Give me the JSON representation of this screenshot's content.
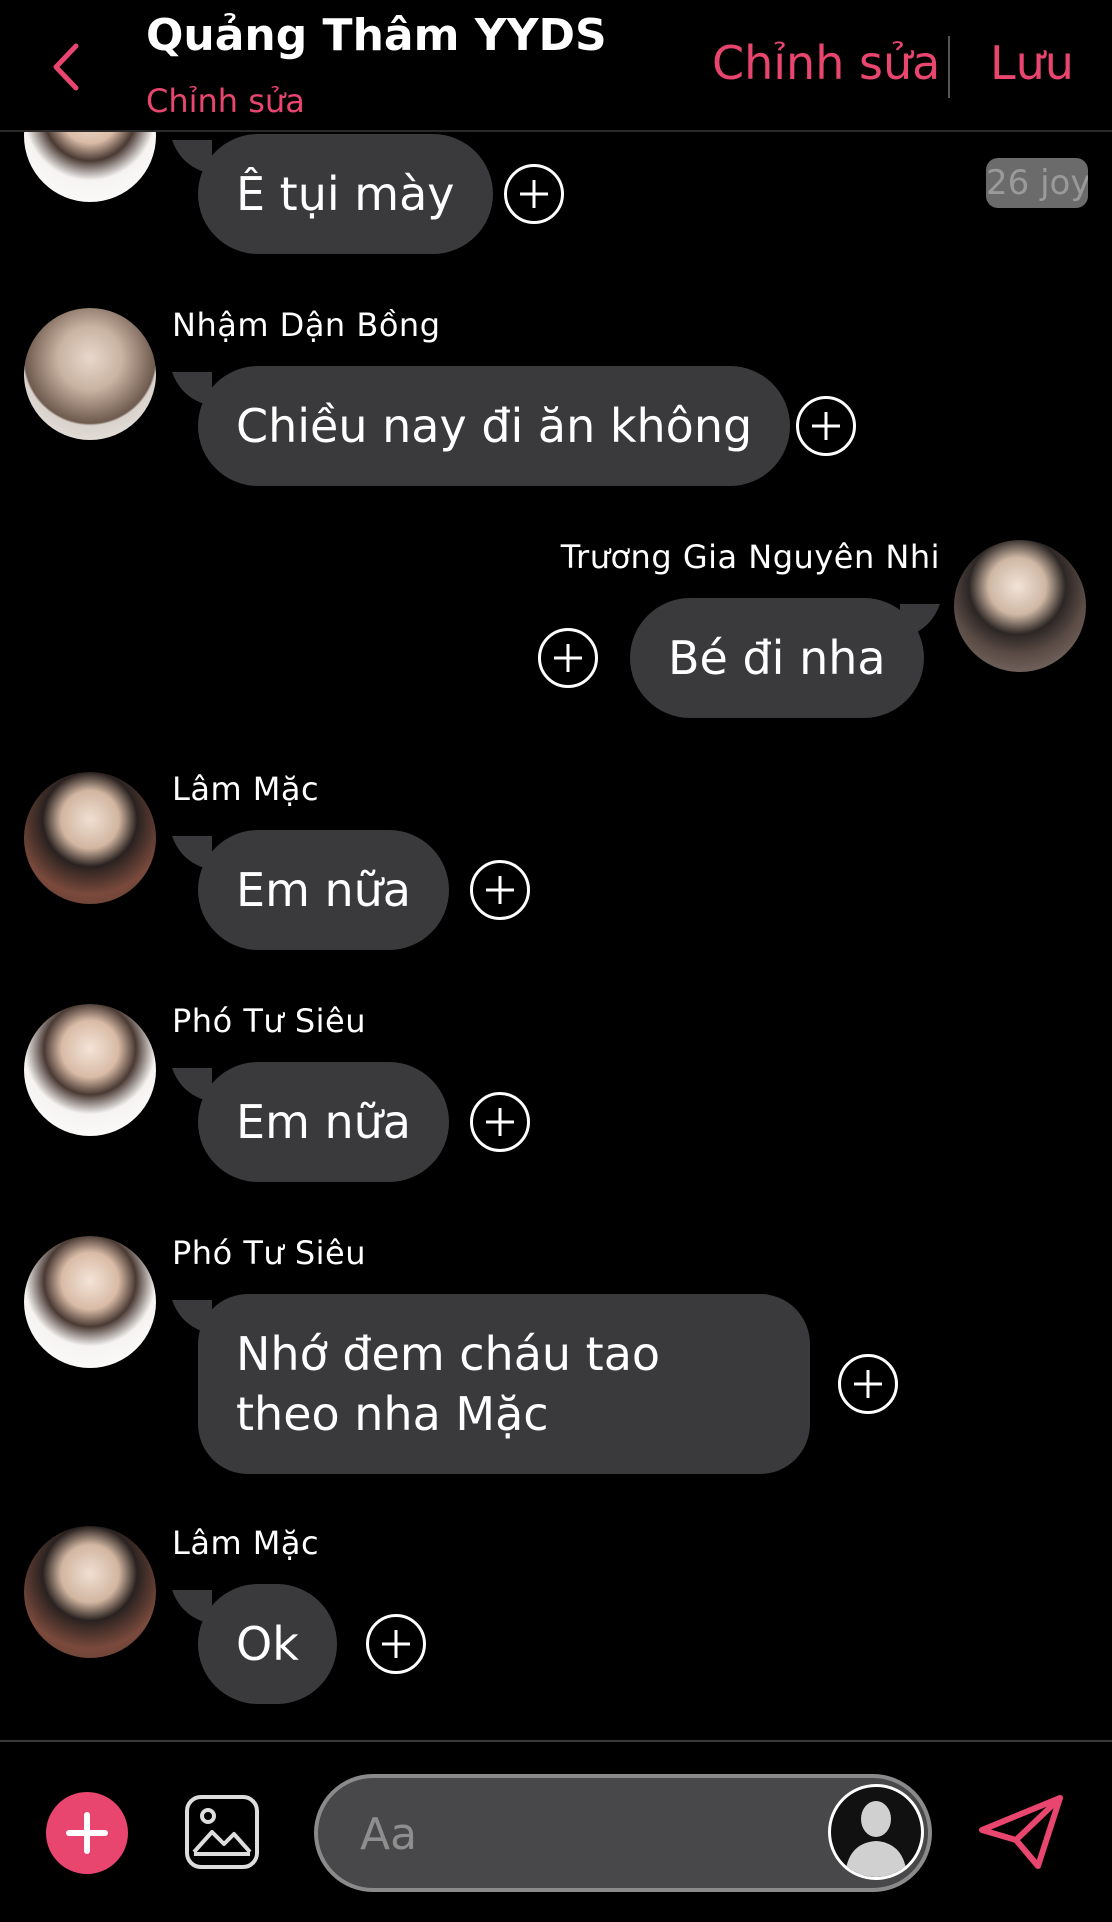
{
  "header": {
    "title": "Quảng Thâm YYDS",
    "subtitle": "Chỉnh sửa",
    "edit_label": "Chỉnh sửa",
    "save_label": "Lưu"
  },
  "colors": {
    "accent": "#e8456f",
    "bubble": "#3a3a3c",
    "background": "#000000"
  },
  "messages": [
    {
      "sender": "",
      "text": "Ê tụi mày",
      "side": "left",
      "timestamp": "26 joy"
    },
    {
      "sender": "Nhậm Dận Bồng",
      "text": "Chiều nay đi ăn không",
      "side": "left"
    },
    {
      "sender": "Trương Gia Nguyên Nhi",
      "text": "Bé đi nha",
      "side": "right"
    },
    {
      "sender": "Lâm Mặc",
      "text": "Em nữa",
      "side": "left"
    },
    {
      "sender": "Phó Tư Siêu",
      "text": "Em nữa",
      "side": "left"
    },
    {
      "sender": "Phó Tư Siêu",
      "text": "Nhớ đem cháu tao theo nha Mặc",
      "side": "left"
    },
    {
      "sender": "Lâm Mặc",
      "text": "Ok",
      "side": "left"
    }
  ],
  "composer": {
    "placeholder": "Aa",
    "icons": [
      "plus-icon",
      "image-icon",
      "person-icon",
      "send-icon"
    ]
  }
}
